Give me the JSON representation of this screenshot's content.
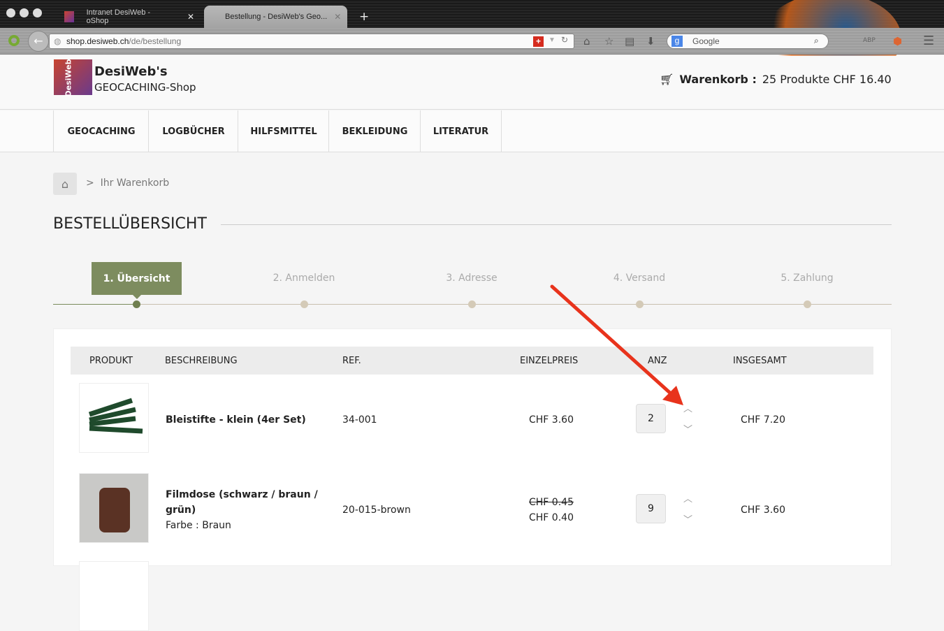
{
  "browser": {
    "tabs": [
      {
        "label": "Intranet DesiWeb - oShop"
      },
      {
        "label": "Bestellung - DesiWeb's Geo..."
      }
    ],
    "url_domain": "shop.desiweb.ch",
    "url_prefix": "",
    "url_path": "/de/bestellung",
    "search_placeholder": "Google"
  },
  "header": {
    "brand_name": "DesiWeb's",
    "brand_sub": "GEOCACHING-Shop",
    "logo_text": "DesiWeb",
    "cart_label": "Warenkorb :",
    "cart_summary": "25 Produkte CHF 16.40"
  },
  "nav": [
    "GEOCACHING",
    "LOGBÜCHER",
    "HILFSMITTEL",
    "BEKLEIDUNG",
    "LITERATUR"
  ],
  "breadcrumb": {
    "sep": ">",
    "current": "Ihr Warenkorb"
  },
  "page_title": "BESTELLÜBERSICHT",
  "steps": [
    "1. Übersicht",
    "2. Anmelden",
    "3. Adresse",
    "4. Versand",
    "5. Zahlung"
  ],
  "table": {
    "headers": [
      "PRODUKT",
      "BESCHREIBUNG",
      "REF.",
      "EINZELPREIS",
      "ANZ",
      "INSGESAMT"
    ],
    "rows": [
      {
        "name": "Bleistifte - klein (4er Set)",
        "variant": "",
        "ref": "34-001",
        "old_price": "",
        "price": "CHF 3.60",
        "qty": "2",
        "total": "CHF 7.20"
      },
      {
        "name": "Filmdose (schwarz / braun / grün)",
        "variant": "Farbe : Braun",
        "ref": "20-015-brown",
        "old_price": "CHF 0.45",
        "price": "CHF 0.40",
        "qty": "9",
        "total": "CHF 3.60"
      }
    ]
  },
  "colors": {
    "accent": "#7d8c5f",
    "annotation_arrow": "#e8331c"
  }
}
